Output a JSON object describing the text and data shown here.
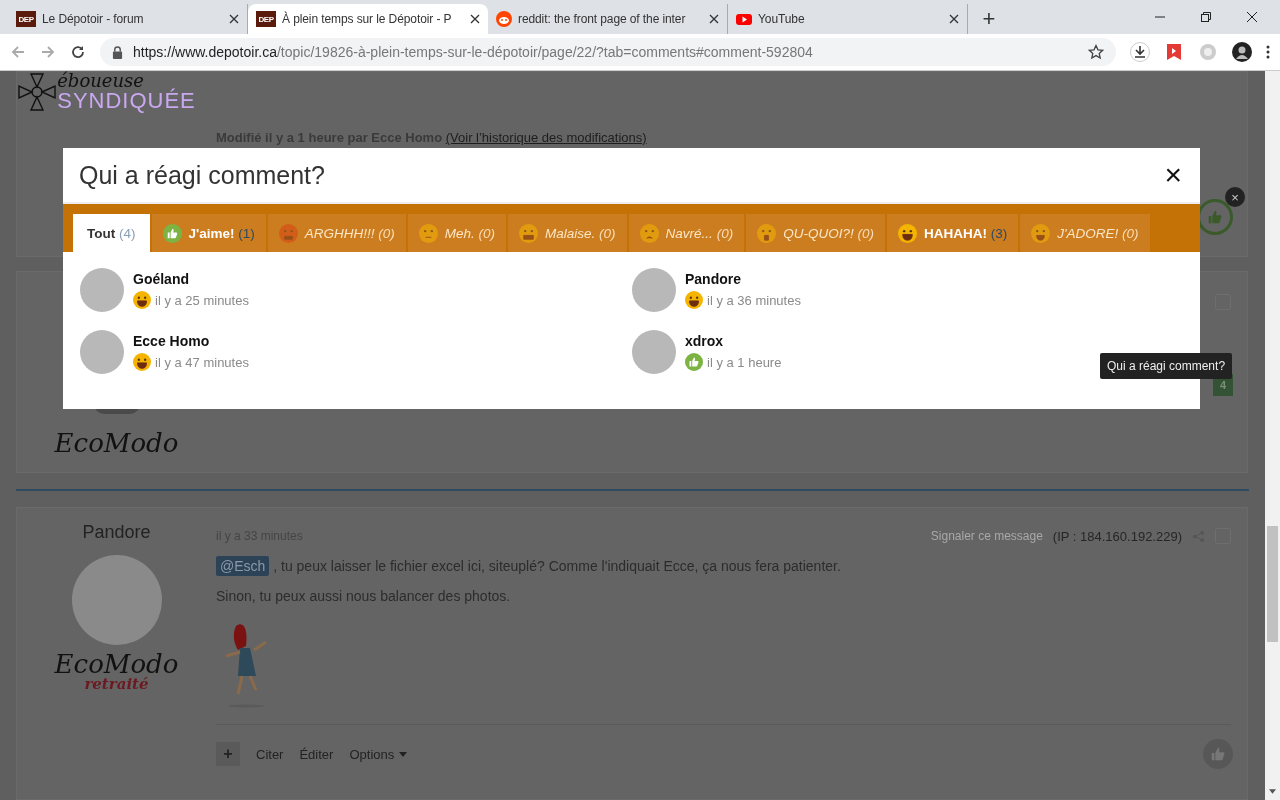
{
  "browser": {
    "tabs": [
      {
        "kind": "dep",
        "favicon_text": "DEP",
        "title": "Le Dépotoir - forum",
        "selected": false
      },
      {
        "kind": "dep",
        "favicon_text": "DEP",
        "title": "À plein temps sur le Dépotoir - P",
        "selected": true
      },
      {
        "kind": "reddit",
        "title": "reddit: the front page of the inter",
        "selected": false
      },
      {
        "kind": "youtube",
        "title": "YouTube",
        "selected": false
      }
    ],
    "new_tab": "+",
    "url_host": "https://www.depotoir.ca",
    "url_path": "/topic/19826-à-plein-temps-sur-le-dépotoir/page/22/?tab=comments#comment-592804"
  },
  "posts": [
    {
      "kind": "top",
      "logo_top": "éboueuse",
      "logo_bottom": "SYNDIQUÉE",
      "edit_note": "Modifié il y a 1 heure par Ecce Homo",
      "edit_link": "(Voir l’historique des modifications)"
    },
    {
      "kind": "middle",
      "logo": "EcoModo",
      "reaction_count": "4",
      "checked": false
    },
    {
      "kind": "full",
      "author": "Pandore",
      "time": "il y a 33 minutes",
      "report": "Signaler ce message",
      "checked": false,
      "ip": "(IP : 184.160.192.229)",
      "mention": "@Esch",
      "text": ", tu peux laisser le fichier excel ici, siteuplé? Comme l'indiquait Ecce, ça nous fera patienter.",
      "text2": "Sinon, tu peux aussi nous balancer des photos.",
      "logo": "EcoModo",
      "logo_sub": "retraité",
      "actions": {
        "plus": "+",
        "quote": "Citer",
        "edit": "Éditer",
        "options": "Options"
      }
    }
  ],
  "modal": {
    "title": "Qui a réagi comment?",
    "close": "×",
    "tabs": [
      {
        "kind": "all",
        "label": "Tout",
        "count": "(4)",
        "selected": true,
        "disabled": false
      },
      {
        "kind": "like",
        "label": "J'aime!",
        "count": "(1)",
        "selected": false,
        "disabled": false
      },
      {
        "kind": "angry",
        "label": "ARGHHH!!!",
        "count": "(0)",
        "selected": false,
        "disabled": true
      },
      {
        "kind": "meh",
        "label": "Meh.",
        "count": "(0)",
        "selected": false,
        "disabled": true
      },
      {
        "kind": "malaise",
        "label": "Malaise.",
        "count": "(0)",
        "selected": false,
        "disabled": true
      },
      {
        "kind": "sad",
        "label": "Navré...",
        "count": "(0)",
        "selected": false,
        "disabled": true
      },
      {
        "kind": "shock",
        "label": "QU-QUOI?!",
        "count": "(0)",
        "selected": false,
        "disabled": true
      },
      {
        "kind": "laugh",
        "label": "HAHAHA!",
        "count": "(3)",
        "selected": false,
        "disabled": false
      },
      {
        "kind": "love",
        "label": "J'ADORE!",
        "count": "(0)",
        "selected": false,
        "disabled": true
      }
    ],
    "reactors": [
      {
        "name": "Goéland",
        "kind": "laugh",
        "time": "il y a 25 minutes"
      },
      {
        "name": "Pandore",
        "kind": "laugh",
        "time": "il y a 36 minutes"
      },
      {
        "name": "Ecce Homo",
        "kind": "laugh",
        "time": "il y a 47 minutes"
      },
      {
        "name": "xdrox",
        "kind": "like",
        "time": "il y a 1 heure"
      }
    ]
  },
  "tooltip": "Qui a réagi comment?",
  "close_badge": "×"
}
